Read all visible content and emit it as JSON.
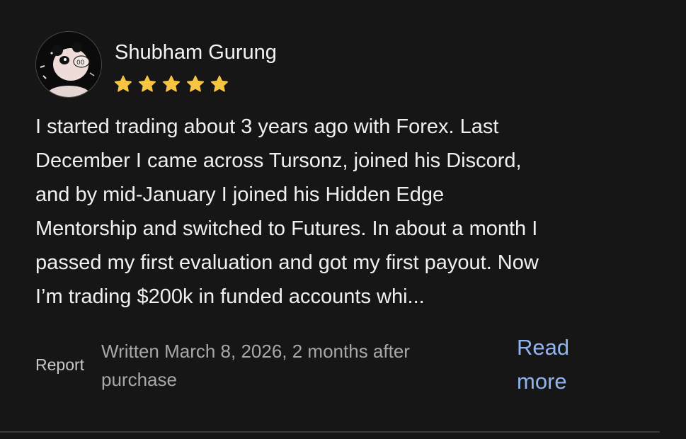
{
  "review": {
    "reviewer_name": "Shubham Gurung",
    "avatar_icon": "panda-avatar-icon",
    "rating": 5,
    "rating_max": 5,
    "star_color": "#f6c544",
    "text_lines": [
      "I started trading about 3 years ago with Forex. Last",
      "December I came across Tursonz, joined his Discord,",
      "and by mid-January I joined his Hidden Edge",
      "Mentorship and switched to Futures. In about a month I",
      "passed my first evaluation and got my first payout. Now",
      "I’m trading $200k in funded accounts whi..."
    ],
    "report_label": "Report",
    "written_lines": [
      "Written March 8, 2026, 2 months after",
      "purchase"
    ],
    "read_more_lines": [
      "Read",
      "more"
    ],
    "link_color": "#8fb4f0"
  }
}
